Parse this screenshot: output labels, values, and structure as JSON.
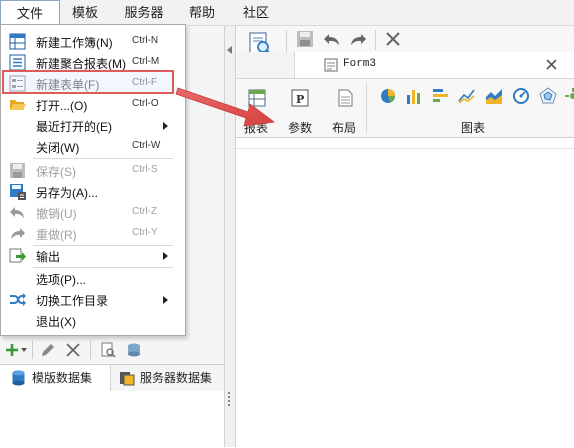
{
  "menubar": {
    "items": [
      "文件",
      "模板",
      "服务器",
      "帮助",
      "社区"
    ]
  },
  "file_menu": {
    "items": [
      {
        "label": "新建工作簿(N)",
        "shortcut": "Ctrl-N",
        "icon": "new-workbook-icon",
        "disabled": false
      },
      {
        "label": "新建聚合报表(M)",
        "shortcut": "Ctrl-M",
        "icon": "new-aggregate-report-icon",
        "disabled": false
      },
      {
        "label": "新建表单(F)",
        "shortcut": "Ctrl-F",
        "icon": "new-form-icon",
        "disabled": false
      },
      {
        "label": "打开...(O)",
        "shortcut": "Ctrl-O",
        "icon": "open-folder-icon",
        "disabled": false
      },
      {
        "label": "最近打开的(E)",
        "shortcut": "",
        "icon": "",
        "disabled": false,
        "submenu": true
      },
      {
        "label": "关闭(W)",
        "shortcut": "Ctrl-W",
        "icon": "",
        "disabled": false
      },
      {
        "label": "保存(S)",
        "shortcut": "Ctrl-S",
        "icon": "save-icon",
        "disabled": true
      },
      {
        "label": "另存为(A)...",
        "shortcut": "",
        "icon": "save-as-icon",
        "disabled": false
      },
      {
        "label": "撤销(U)",
        "shortcut": "Ctrl-Z",
        "icon": "undo-icon",
        "disabled": true
      },
      {
        "label": "重做(R)",
        "shortcut": "Ctrl-Y",
        "icon": "redo-icon",
        "disabled": true
      },
      {
        "label": "输出",
        "shortcut": "",
        "icon": "export-icon",
        "disabled": false,
        "submenu": true
      },
      {
        "label": "选项(P)...",
        "shortcut": "",
        "icon": "",
        "disabled": false
      },
      {
        "label": "切换工作目录",
        "shortcut": "",
        "icon": "switch-directory-icon",
        "disabled": false,
        "submenu": true
      },
      {
        "label": "退出(X)",
        "shortcut": "",
        "icon": "",
        "disabled": false
      }
    ]
  },
  "tab": {
    "title": "Form3"
  },
  "ribbon": {
    "groups": [
      "报表",
      "参数",
      "布局",
      "图表"
    ]
  },
  "dataset": {
    "tabs": [
      "模版数据集",
      "服务器数据集"
    ]
  },
  "colors": {
    "highlight": "#e05a5a",
    "arrow": "#e05a5a",
    "accent": "#2f7cc5"
  }
}
